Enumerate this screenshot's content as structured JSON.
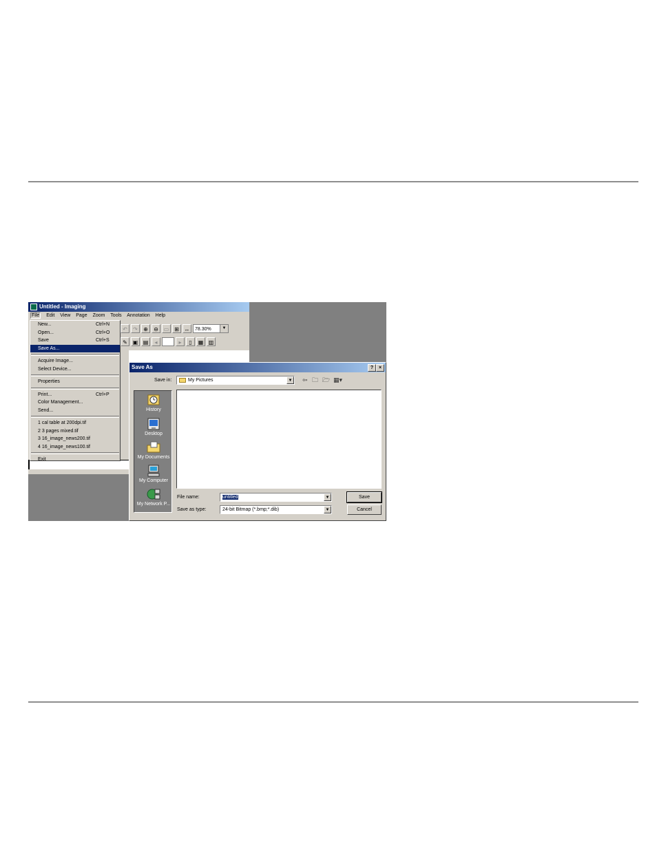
{
  "imaging": {
    "title": "Untitled - Imaging",
    "menu": [
      "File",
      "Edit",
      "View",
      "Page",
      "Zoom",
      "Tools",
      "Annotation",
      "Help"
    ],
    "zoom": "78.30%",
    "file_menu": {
      "items": [
        {
          "label": "New...",
          "shortcut": "Ctrl+N"
        },
        {
          "label": "Open...",
          "shortcut": "Ctrl+O"
        },
        {
          "label": "Save",
          "shortcut": "Ctrl+S"
        },
        {
          "label": "Save As...",
          "shortcut": ""
        },
        {
          "label": "Acquire Image...",
          "shortcut": ""
        },
        {
          "label": "Select Device...",
          "shortcut": ""
        },
        {
          "label": "Properties",
          "shortcut": ""
        },
        {
          "label": "Print...",
          "shortcut": "Ctrl+P"
        },
        {
          "label": "Color Management...",
          "shortcut": ""
        },
        {
          "label": "Send...",
          "shortcut": ""
        },
        {
          "label": "1 cal table at 200dpi.tif",
          "shortcut": ""
        },
        {
          "label": "2 3 pages mixed.tif",
          "shortcut": ""
        },
        {
          "label": "3 16_image_news200.tif",
          "shortcut": ""
        },
        {
          "label": "4 16_image_news100.tif",
          "shortcut": ""
        },
        {
          "label": "Exit",
          "shortcut": ""
        }
      ],
      "selected": "Save As..."
    }
  },
  "save_as": {
    "title": "Save As",
    "help_button": "?",
    "close_button": "×",
    "save_in_label": "Save in:",
    "save_in_value": "My Pictures",
    "places": [
      "History",
      "Desktop",
      "My Documents",
      "My Computer",
      "My Network P..."
    ],
    "file_name_label": "File name:",
    "file_name_value": "untitled",
    "save_as_type_label": "Save as type:",
    "save_as_type_value": "24-bit Bitmap (*.bmp;*.dib)",
    "save_button": "Save",
    "cancel_button": "Cancel"
  }
}
